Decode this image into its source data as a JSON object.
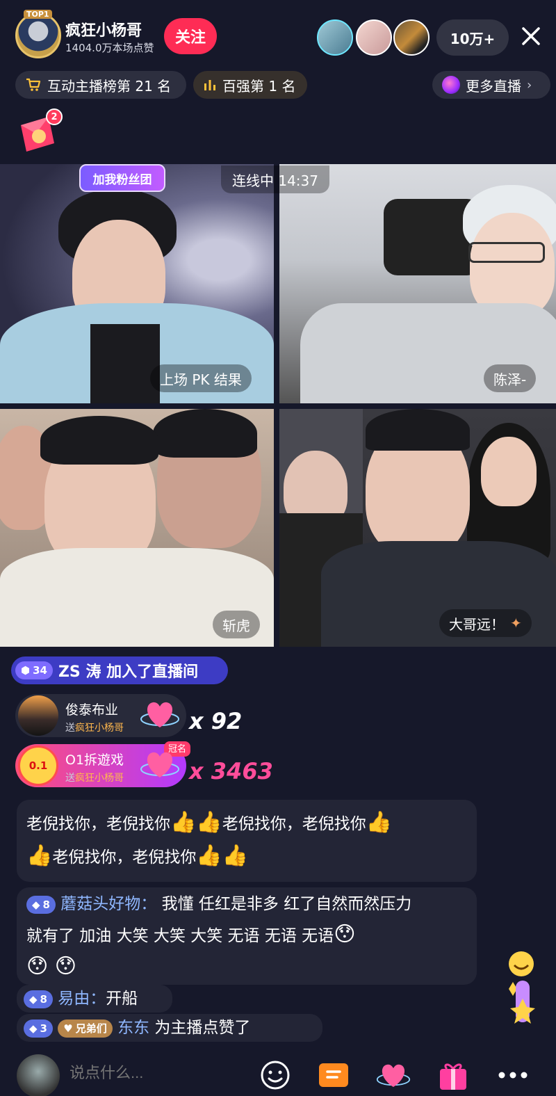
{
  "header": {
    "host_name": "疯狂小杨哥",
    "host_likes": "1404.0万本场点赞",
    "top_badge": "TOP1",
    "follow_label": "关注",
    "viewers_count": "10万+",
    "close_icon": "close-icon"
  },
  "ranks": {
    "interactive_rank": "互动主播榜第 21 名",
    "top100": "百强第 1 名",
    "more_live": "更多直播"
  },
  "redpack": {
    "badge_count": "2"
  },
  "video": {
    "link_timer": "连线中 14:37",
    "fan_banner": "加我粉丝团",
    "tile1_label": "上场 PK 结果",
    "tile2_label": "陈泽-",
    "tile3_label": "斩虎",
    "tile4_label": "大哥远！"
  },
  "chat": {
    "join": {
      "level": "34",
      "text": "ZS 涛 加入了直播间"
    },
    "gifts": [
      {
        "name": "俊泰布业",
        "to_prefix": "送",
        "to_name": "疯狂小杨哥",
        "count": "x 92"
      },
      {
        "name": "O1拆遊戏",
        "to_prefix": "送",
        "to_name": "疯狂小杨哥",
        "count": "x 3463",
        "tag": "冠名"
      }
    ],
    "messages": [
      {
        "lines": [
          "老倪找你，老倪找你",
          "老倪找你，老倪找你",
          "老倪找你，老倪找你"
        ]
      },
      {
        "level": "8",
        "user": "蘑菇头好物：",
        "text": "我懂 任红是非多 红了自然而然压力",
        "text2": "就有了 加油 大笑  大笑  大笑 无语  无语  无语"
      },
      {
        "level": "8",
        "user": "易由：",
        "text": "开船"
      },
      {
        "level": "3",
        "fan_tag": "兄弟们",
        "user": "东东",
        "text": "为主播点赞了"
      }
    ]
  },
  "bottom": {
    "input_placeholder": "说点什么..."
  },
  "colors": {
    "accent_red": "#fe2c55",
    "chat_username": "#8fb7ff",
    "gift_gold": "#ffb84d"
  }
}
